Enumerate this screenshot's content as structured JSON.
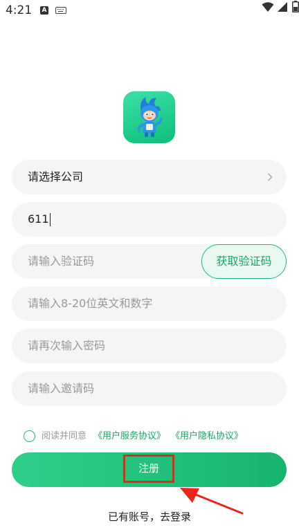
{
  "status_bar": {
    "time": "4:21",
    "icons": [
      "a-icon",
      "keyboard-icon",
      "wifi-icon",
      "signal-icon",
      "battery-icon"
    ]
  },
  "app": {
    "logo": "mascot-logo",
    "brand_color": "#1bbd75"
  },
  "form": {
    "company_select": {
      "label": "请选择公司"
    },
    "phone": {
      "value": "611"
    },
    "verify_code": {
      "placeholder": "请输入验证码",
      "button_label": "获取验证码"
    },
    "password": {
      "placeholder": "请输入8-20位英文和数字"
    },
    "password_confirm": {
      "placeholder": "请再次输入密码"
    },
    "invite_code": {
      "placeholder": "请输入邀请码"
    }
  },
  "agreement": {
    "text": "阅读并同意",
    "service_link": "《用户服务协议》",
    "privacy_link": "《用户隐私协议》",
    "checked": false
  },
  "register_button": {
    "label": "注册"
  },
  "login_link": {
    "label": "已有账号，去登录"
  },
  "annotation": {
    "highlight_color": "#e8261a"
  }
}
